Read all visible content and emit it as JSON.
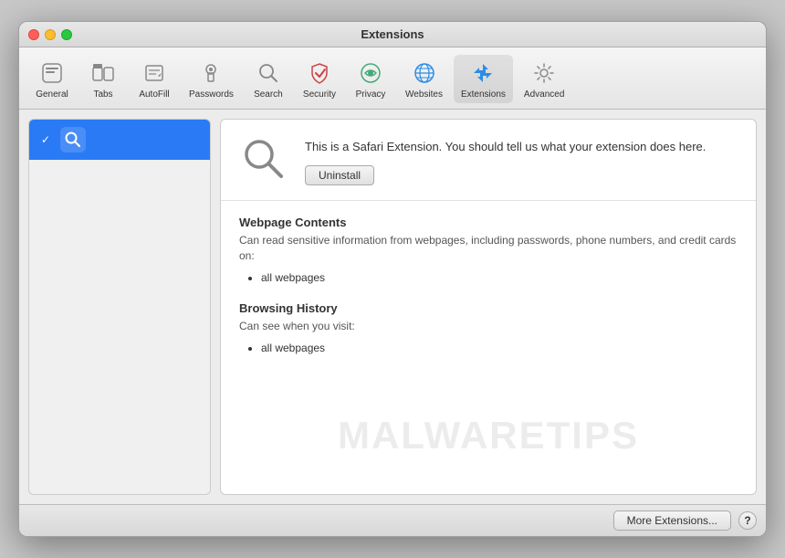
{
  "window": {
    "title": "Extensions"
  },
  "toolbar": {
    "items": [
      {
        "id": "general",
        "label": "General",
        "icon": "general"
      },
      {
        "id": "tabs",
        "label": "Tabs",
        "icon": "tabs"
      },
      {
        "id": "autofill",
        "label": "AutoFill",
        "icon": "autofill"
      },
      {
        "id": "passwords",
        "label": "Passwords",
        "icon": "passwords"
      },
      {
        "id": "search",
        "label": "Search",
        "icon": "search"
      },
      {
        "id": "security",
        "label": "Security",
        "icon": "security"
      },
      {
        "id": "privacy",
        "label": "Privacy",
        "icon": "privacy"
      },
      {
        "id": "websites",
        "label": "Websites",
        "icon": "websites"
      },
      {
        "id": "extensions",
        "label": "Extensions",
        "icon": "extensions",
        "active": true
      },
      {
        "id": "advanced",
        "label": "Advanced",
        "icon": "advanced"
      }
    ]
  },
  "sidebar": {
    "items": [
      {
        "id": "search-ext",
        "label": "Search",
        "enabled": true,
        "active": true
      }
    ]
  },
  "detail": {
    "description": "This is a Safari Extension. You should tell us what your extension does here.",
    "uninstall_label": "Uninstall",
    "sections": [
      {
        "title": "Webpage Contents",
        "description": "Can read sensitive information from webpages, including passwords, phone numbers, and credit cards on:",
        "items": [
          "all webpages"
        ]
      },
      {
        "title": "Browsing History",
        "description": "Can see when you visit:",
        "items": [
          "all webpages"
        ]
      }
    ]
  },
  "footer": {
    "more_extensions_label": "More Extensions...",
    "help_label": "?"
  },
  "watermark": {
    "text": "MALWARETIPS"
  },
  "traffic_lights": {
    "close": "close",
    "minimize": "minimize",
    "maximize": "maximize"
  }
}
